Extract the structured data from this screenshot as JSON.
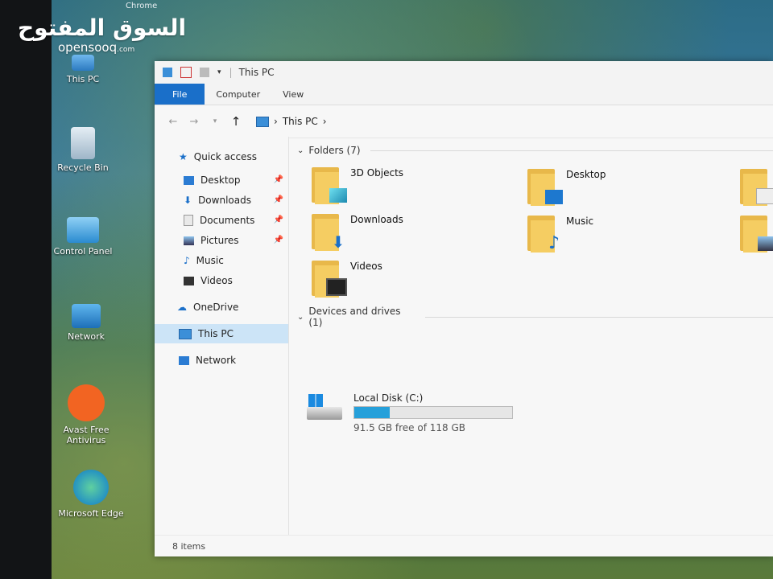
{
  "watermark": {
    "arabic": "السوق المفتوح",
    "latin": "opensooq",
    "suffix": ".com"
  },
  "desktop": {
    "top_label": "Chrome",
    "icons": [
      {
        "label": "This PC"
      },
      {
        "label": "Recycle Bin"
      },
      {
        "label": "Control Panel"
      },
      {
        "label": "Network"
      },
      {
        "label": "Avast Free Antivirus"
      },
      {
        "label": "Microsoft Edge"
      }
    ]
  },
  "window": {
    "title": "This PC",
    "ribbon_tabs": [
      "File",
      "Computer",
      "View"
    ],
    "breadcrumb": "This PC",
    "sidebar": {
      "quick_access": "Quick access",
      "quick_items": [
        {
          "label": "Desktop",
          "pinned": true
        },
        {
          "label": "Downloads",
          "pinned": true
        },
        {
          "label": "Documents",
          "pinned": true
        },
        {
          "label": "Pictures",
          "pinned": true
        },
        {
          "label": "Music",
          "pinned": false
        },
        {
          "label": "Videos",
          "pinned": false
        }
      ],
      "onedrive": "OneDrive",
      "this_pc": "This PC",
      "network": "Network"
    },
    "folders_header": "Folders (7)",
    "folders": [
      {
        "label": "3D Objects"
      },
      {
        "label": "Desktop"
      },
      {
        "label": "Downloads"
      },
      {
        "label": "Music"
      },
      {
        "label": "Videos"
      }
    ],
    "drives_header": "Devices and drives (1)",
    "drive": {
      "label": "Local Disk (C:)",
      "free_text": "91.5 GB free of 118 GB",
      "used_fraction": 0.225
    },
    "status": "8 items"
  },
  "colors": {
    "accent": "#1a6fc9",
    "selected": "#cce4f7",
    "folder": "#f5cd62",
    "drive_bar": "#26a0da"
  }
}
